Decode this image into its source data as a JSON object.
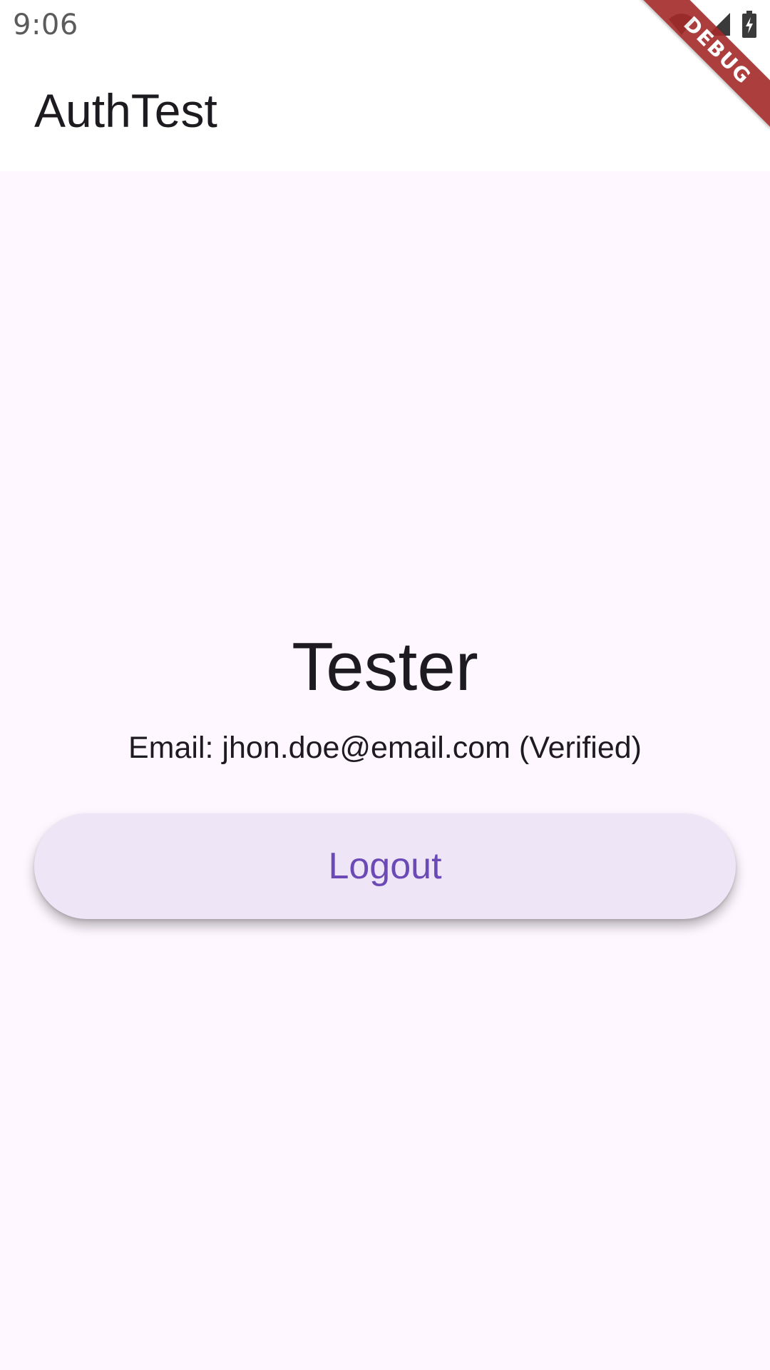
{
  "status_bar": {
    "time": "9:06",
    "icons": [
      "wifi-icon",
      "signal-icon",
      "battery-icon"
    ]
  },
  "app_bar": {
    "title": "AuthTest"
  },
  "profile": {
    "name": "Tester",
    "email_line": "Email: jhon.doe@email.com (Verified)"
  },
  "actions": {
    "logout_label": "Logout"
  },
  "debug_banner": {
    "label": "DEBUG"
  },
  "colors": {
    "background": "#fef7ff",
    "button_fill": "#eee6f6",
    "button_text": "#6c4ab6",
    "debug_banner": "#a52a2a"
  }
}
